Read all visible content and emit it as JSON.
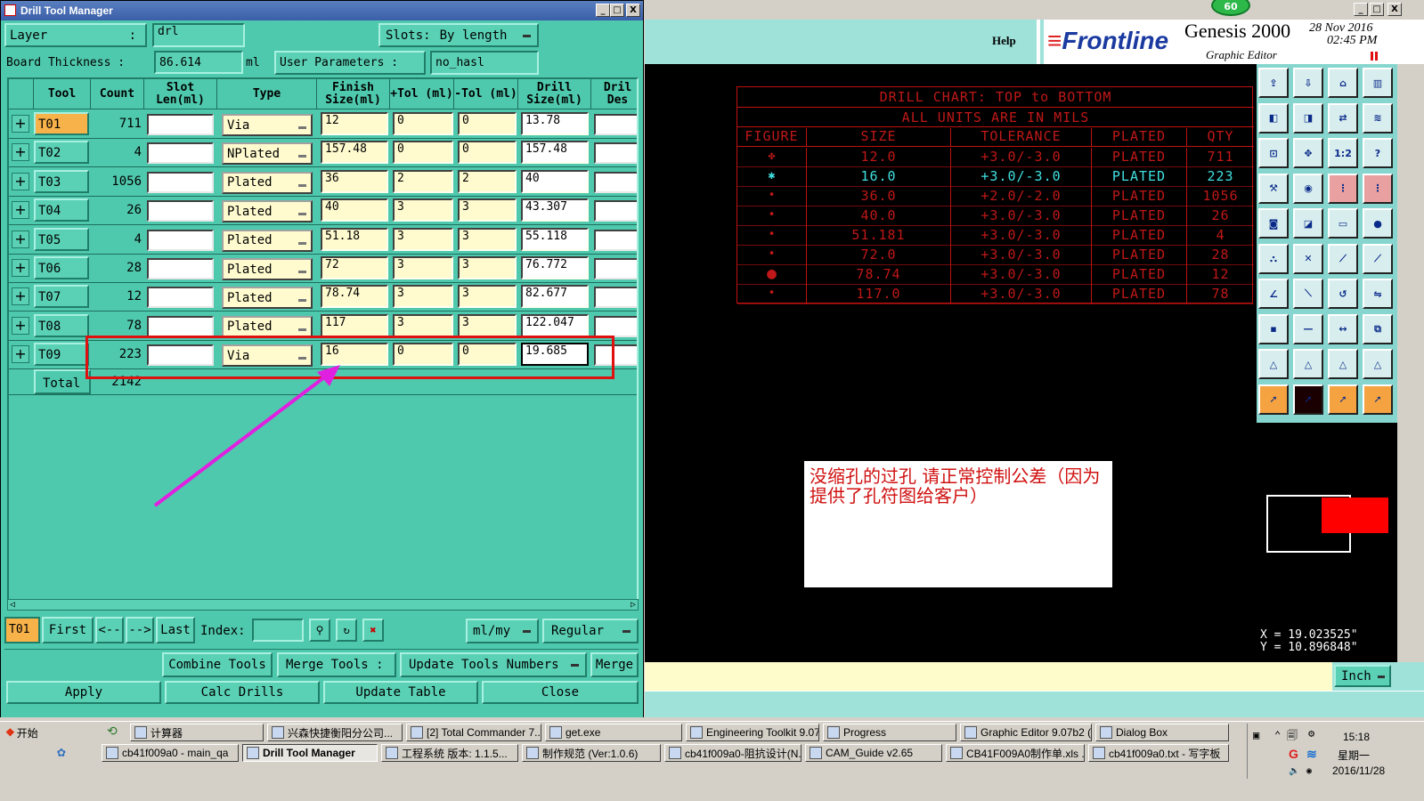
{
  "window": {
    "title": "Drill Tool Manager",
    "minimize": "_",
    "maximize": "□",
    "close": "X"
  },
  "top": {
    "layer_label": "Layer",
    "layer_colon": ":",
    "layer_value": "drl",
    "slots_label": "Slots:",
    "slots_value": "By length",
    "board_thickness_label": "Board Thickness :",
    "board_thickness_value": "86.614",
    "board_thickness_unit": "ml",
    "user_params_label": "User Parameters :",
    "user_params_value": "no_hasl"
  },
  "table": {
    "headers": {
      "tool": "Tool",
      "count": "Count",
      "slot_len": "Slot Len(ml)",
      "type": "Type",
      "finish_size": "Finish Size(ml)",
      "plus_tol": "+Tol (ml)",
      "minus_tol": "-Tol (ml)",
      "drill_size": "Drill Size(ml)",
      "drill_des": "Dril Des"
    },
    "rows": [
      {
        "tool": "T01",
        "count": "711",
        "type": "Via",
        "finish": "12",
        "ptol": "0",
        "mtol": "0",
        "drill": "13.78"
      },
      {
        "tool": "T02",
        "count": "4",
        "type": "NPlated",
        "finish": "157.48",
        "ptol": "0",
        "mtol": "0",
        "drill": "157.48"
      },
      {
        "tool": "T03",
        "count": "1056",
        "type": "Plated",
        "finish": "36",
        "ptol": "2",
        "mtol": "2",
        "drill": "40"
      },
      {
        "tool": "T04",
        "count": "26",
        "type": "Plated",
        "finish": "40",
        "ptol": "3",
        "mtol": "3",
        "drill": "43.307"
      },
      {
        "tool": "T05",
        "count": "4",
        "type": "Plated",
        "finish": "51.18",
        "ptol": "3",
        "mtol": "3",
        "drill": "55.118"
      },
      {
        "tool": "T06",
        "count": "28",
        "type": "Plated",
        "finish": "72",
        "ptol": "3",
        "mtol": "3",
        "drill": "76.772"
      },
      {
        "tool": "T07",
        "count": "12",
        "type": "Plated",
        "finish": "78.74",
        "ptol": "3",
        "mtol": "3",
        "drill": "82.677"
      },
      {
        "tool": "T08",
        "count": "78",
        "type": "Plated",
        "finish": "117",
        "ptol": "3",
        "mtol": "3",
        "drill": "122.047"
      },
      {
        "tool": "T09",
        "count": "223",
        "type": "Via",
        "finish": "16",
        "ptol": "0",
        "mtol": "0",
        "drill": "19.685"
      }
    ],
    "total_label": "Total",
    "total_value": "2142"
  },
  "nav": {
    "current_tool": "T01",
    "first": "First",
    "prev": "<--",
    "next": "-->",
    "last": "Last",
    "index_label": "Index:",
    "units": "ml/my",
    "mode": "Regular"
  },
  "actions": {
    "combine_tools": "Combine Tools",
    "merge_tools": "Merge Tools :",
    "update_tools_numbers": "Update Tools Numbers",
    "merge": "Merge",
    "apply": "Apply",
    "calc_drills": "Calc Drills",
    "update_table": "Update Table",
    "close": "Close"
  },
  "genesis": {
    "badge": "60",
    "help": "Help",
    "logo": "Frontline",
    "product": "Genesis 2000",
    "date": "28 Nov 2016",
    "time": "02:45 PM",
    "subtitle": "Graphic Editor",
    "win_min": "_",
    "win_max": "□",
    "win_close": "X"
  },
  "drill_chart": {
    "title": "DRILL CHART: TOP to BOTTOM",
    "units_note": "ALL UNITS ARE IN MILS",
    "headers": [
      "FIGURE",
      "SIZE",
      "TOLERANCE",
      "PLATED",
      "QTY"
    ],
    "rows": [
      {
        "size": "12.0",
        "tol": "+3.0/-3.0",
        "plated": "PLATED",
        "qty": "711"
      },
      {
        "size": "16.0",
        "tol": "+3.0/-3.0",
        "plated": "PLATED",
        "qty": "223"
      },
      {
        "size": "36.0",
        "tol": "+2.0/-2.0",
        "plated": "PLATED",
        "qty": "1056"
      },
      {
        "size": "40.0",
        "tol": "+3.0/-3.0",
        "plated": "PLATED",
        "qty": "26"
      },
      {
        "size": "51.181",
        "tol": "+3.0/-3.0",
        "plated": "PLATED",
        "qty": "4"
      },
      {
        "size": "72.0",
        "tol": "+3.0/-3.0",
        "plated": "PLATED",
        "qty": "28"
      },
      {
        "size": "78.74",
        "tol": "+3.0/-3.0",
        "plated": "PLATED",
        "qty": "12"
      },
      {
        "size": "117.0",
        "tol": "+3.0/-3.0",
        "plated": "PLATED",
        "qty": "78"
      }
    ]
  },
  "annotation": {
    "note": "没缩孔的过孔  请正常控制公差（因为提供了孔符图给客户）"
  },
  "palette_labels": {
    "ratio": "1:2",
    "question": "?"
  },
  "coords": {
    "x": "X = 19.023525\"",
    "y": "Y = 10.896848\""
  },
  "unit_select": "Inch",
  "taskbar": {
    "start": "开始",
    "row1": [
      "计算器",
      "兴森快捷衡阳分公司...",
      "[2] Total Commander 7....",
      "get.exe",
      "Engineering Toolkit 9.07...",
      "Progress",
      "Graphic Editor 9.07b2 (0...",
      "Dialog Box"
    ],
    "row2": [
      "cb41f009a0 - main_qa",
      "Drill Tool Manager",
      "工程系统  版本: 1.1.5...",
      "制作规范 (Ver:1.0.6)",
      "cb41f009a0-阻抗设计(N...",
      "CAM_Guide v2.65",
      "CB41F009A0制作单.xls ...",
      "cb41f009a0.txt - 写字板"
    ],
    "clock": "15:18",
    "weekday": "星期一",
    "date": "2016/11/28"
  },
  "colors": {
    "teal": "#4fc9ad",
    "highlight_red": "#e01010",
    "arrow_magenta": "#e020e0",
    "chart_red": "#c01818",
    "chart_cyan": "#40e0e0"
  }
}
